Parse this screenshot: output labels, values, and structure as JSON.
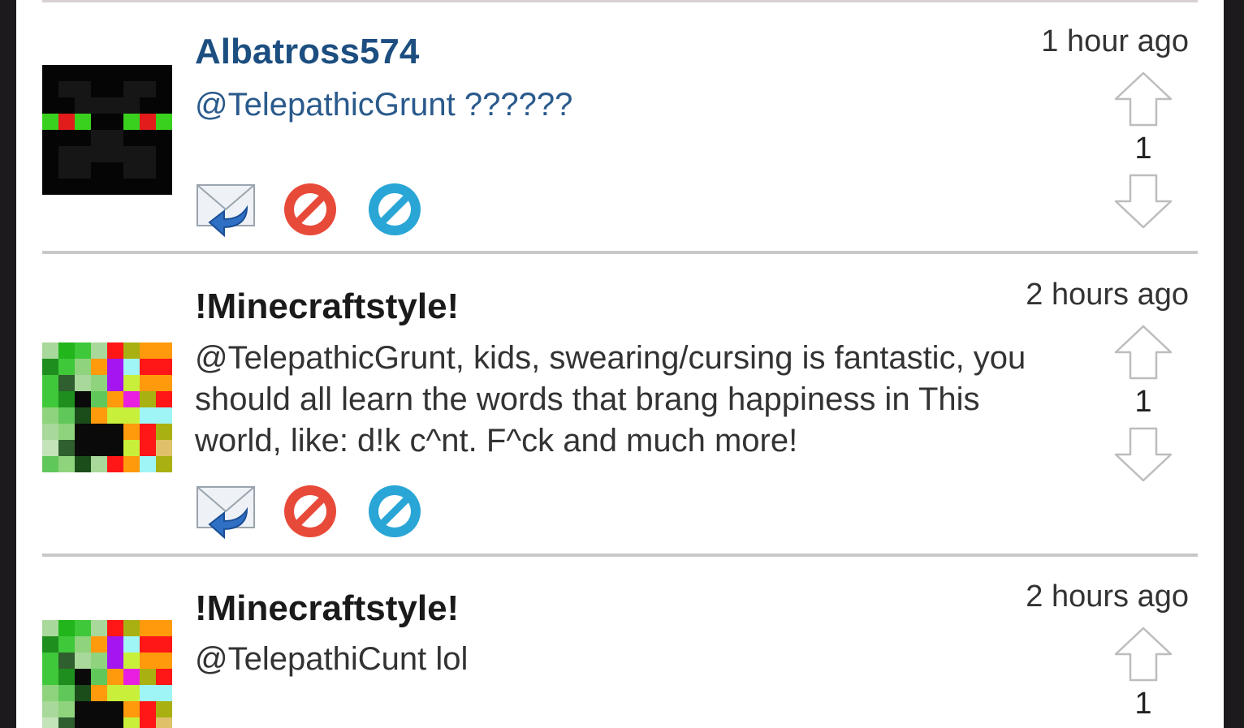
{
  "comments": [
    {
      "username": "Albatross574",
      "text": "@TelepathicGrunt ??????",
      "time": "1 hour ago",
      "votes": "1"
    },
    {
      "username": "!Minecraftstyle!",
      "text": "@TelepathicGrunt, kids, swearing/cursing is fantastic, you should all learn the words that brang happiness in This world, like: d!k c^nt. F^ck and much more!",
      "time": "2 hours ago",
      "votes": "1"
    },
    {
      "username": "!Minecraftstyle!",
      "text": "@TelepathiCunt lol",
      "time": "2 hours ago",
      "votes": "1"
    }
  ],
  "icons": {
    "reply": "reply-mail-icon",
    "report": "report-icon",
    "block": "block-icon",
    "upvote": "upvote-arrow-icon",
    "downvote": "downvote-arrow-icon"
  },
  "colors": {
    "username_link": "#1c4e80",
    "report_red": "#e84a3a",
    "block_blue": "#2aa6d6"
  }
}
